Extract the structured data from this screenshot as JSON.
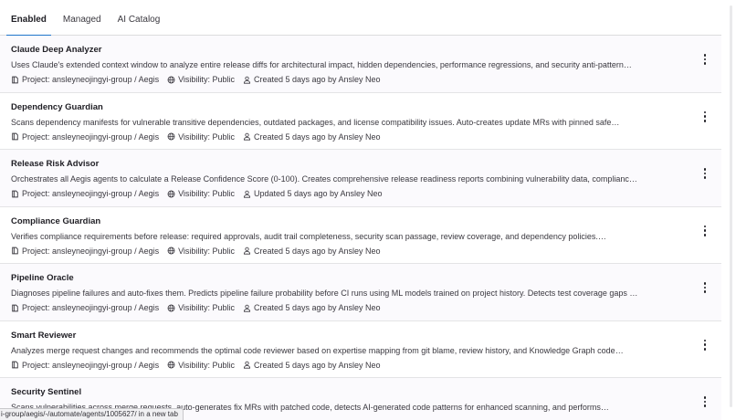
{
  "tabs": [
    {
      "label": "Enabled",
      "active": true
    },
    {
      "label": "Managed",
      "active": false
    },
    {
      "label": "AI Catalog",
      "active": false
    }
  ],
  "agents": [
    {
      "name": "Claude Deep Analyzer",
      "description": "Uses Claude's extended context window to analyze entire release diffs for architectural impact, hidden dependencies, performance regressions, and security anti-pattern…",
      "project": "Project: ansleyneojingyi-group / Aegis",
      "visibility": "Visibility: Public",
      "activity": "Created 5 days ago by Ansley Neo"
    },
    {
      "name": "Dependency Guardian",
      "description": "Scans dependency manifests for vulnerable transitive dependencies, outdated packages, and license compatibility issues. Auto-creates update MRs with pinned safe…",
      "project": "Project: ansleyneojingyi-group / Aegis",
      "visibility": "Visibility: Public",
      "activity": "Created 5 days ago by Ansley Neo"
    },
    {
      "name": "Release Risk Advisor",
      "description": "Orchestrates all Aegis agents to calculate a Release Confidence Score (0-100). Creates comprehensive release readiness reports combining vulnerability data, complianc…",
      "project": "Project: ansleyneojingyi-group / Aegis",
      "visibility": "Visibility: Public",
      "activity": "Updated 5 days ago by Ansley Neo"
    },
    {
      "name": "Compliance Guardian",
      "description": "Verifies compliance requirements before release: required approvals, audit trail completeness, security scan passage, review coverage, and dependency policies.…",
      "project": "Project: ansleyneojingyi-group / Aegis",
      "visibility": "Visibility: Public",
      "activity": "Created 5 days ago by Ansley Neo"
    },
    {
      "name": "Pipeline Oracle",
      "description": "Diagnoses pipeline failures and auto-fixes them. Predicts pipeline failure probability before CI runs using ML models trained on project history. Detects test coverage gaps …",
      "project": "Project: ansleyneojingyi-group / Aegis",
      "visibility": "Visibility: Public",
      "activity": "Created 5 days ago by Ansley Neo"
    },
    {
      "name": "Smart Reviewer",
      "description": "Analyzes merge request changes and recommends the optimal code reviewer based on expertise mapping from git blame, review history, and Knowledge Graph code…",
      "project": "Project: ansleyneojingyi-group / Aegis",
      "visibility": "Visibility: Public",
      "activity": "Created 5 days ago by Ansley Neo"
    },
    {
      "name": "Security Sentinel",
      "description": "Scans vulnerabilities across merge requests, auto-generates fix MRs with patched code, detects AI-generated code patterns for enhanced scanning, and performs…",
      "project": "",
      "visibility": "",
      "activity": ""
    }
  ],
  "status_bar": {
    "text": "i-group/aegis/-/automate/agents/1005627/ in a new tab"
  },
  "colors": {
    "accent": "#1f75cb",
    "text": "#333238",
    "border": "#dcdcde"
  },
  "icons": {
    "project": "project-icon",
    "visibility": "globe-icon",
    "activity": "user-icon",
    "actions": "kebab-menu-icon"
  }
}
